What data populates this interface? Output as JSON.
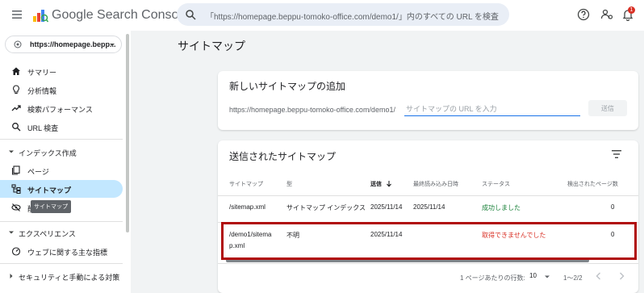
{
  "header": {
    "app_name": "Google Search Console",
    "search_placeholder": "「https://homepage.beppu-tomoko-office.com/demo1/」内のすべての URL を検査",
    "notification_count": "1"
  },
  "sidebar": {
    "property": "https://homepage.bepp...",
    "items_top": [
      {
        "label": "サマリー"
      },
      {
        "label": "分析情報"
      },
      {
        "label": "検索パフォーマンス"
      },
      {
        "label": "URL 検査"
      }
    ],
    "section_index": "インデックス作成",
    "items_index": [
      {
        "label": "ページ"
      },
      {
        "label": "サイトマップ"
      },
      {
        "label": "削除"
      }
    ],
    "tooltip": "サイトマップ",
    "section_experience": "エクスペリエンス",
    "items_experience": [
      {
        "label": "ウェブに関する主な指標"
      }
    ],
    "section_security": "セキュリティと手動による対策"
  },
  "main": {
    "page_title": "サイトマップ",
    "add_card": {
      "title": "新しいサイトマップの追加",
      "prefix": "https://homepage.beppu-tomoko-office.com/demo1/",
      "input_placeholder": "サイトマップの URL を入力",
      "submit_label": "送信"
    },
    "submitted_card": {
      "title": "送信されたサイトマップ",
      "columns": [
        "サイトマップ",
        "型",
        "送信",
        "最終読み込み日時",
        "ステータス",
        "検出されたページ数"
      ],
      "rows": [
        {
          "sitemap": "/sitemap.xml",
          "type": "サイトマップ インデックス",
          "submitted": "2025/11/14",
          "last_read": "2025/11/14",
          "status": "成功しました",
          "pages": "0"
        },
        {
          "sitemap_line1": "/demo1/sitema",
          "sitemap_line2": "p.xml",
          "type": "不明",
          "submitted": "2025/11/14",
          "last_read": "",
          "status": "取得できませんでした",
          "pages": "0"
        }
      ],
      "pager": {
        "rows_per_page_label": "1 ページあたりの行数:",
        "rows_per_page_value": "10",
        "range": "1〜2/2"
      }
    }
  },
  "colors": {
    "accent": "#1a73e8",
    "active_nav": "#c2e7ff",
    "success": "#188038",
    "error": "#d93025",
    "highlight_border": "#b00b0b"
  }
}
